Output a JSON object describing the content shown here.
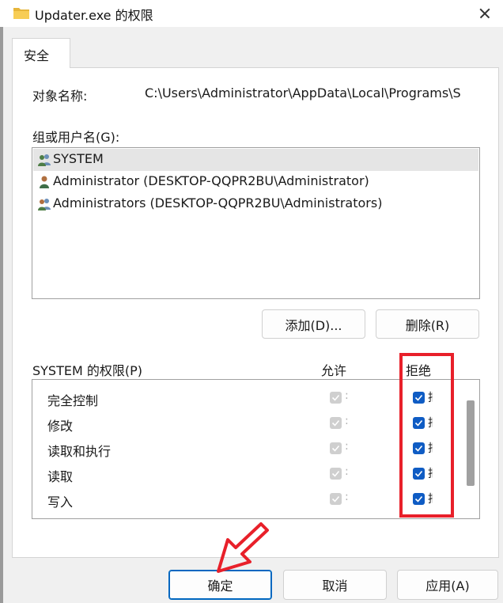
{
  "window": {
    "title": "Updater.exe 的权限",
    "icon": "folder-icon",
    "close_icon": "close-icon"
  },
  "tabs": [
    {
      "label": "安全"
    }
  ],
  "object": {
    "label": "对象名称:",
    "value": "C:\\Users\\Administrator\\AppData\\Local\\Programs\\S"
  },
  "groups": {
    "label": "组或用户名(G):",
    "items": [
      {
        "name": "SYSTEM",
        "icon": "users-group-icon",
        "selected": true
      },
      {
        "name": "Administrator (DESKTOP-QQPR2BU\\Administrator)",
        "icon": "user-icon",
        "selected": false
      },
      {
        "name": "Administrators (DESKTOP-QQPR2BU\\Administrators)",
        "icon": "users-group-icon",
        "selected": false
      }
    ]
  },
  "buttons": {
    "add": "添加(D)...",
    "remove": "删除(R)",
    "ok": "确定",
    "cancel": "取消",
    "apply": "应用(A)"
  },
  "permissions": {
    "header": "SYSTEM 的权限(P)",
    "allow_label": "允许",
    "deny_label": "拒绝",
    "rows": [
      {
        "name": "完全控制",
        "allow": true,
        "allow_disabled": true,
        "deny": true
      },
      {
        "name": "修改",
        "allow": true,
        "allow_disabled": true,
        "deny": true
      },
      {
        "name": "读取和执行",
        "allow": true,
        "allow_disabled": true,
        "deny": true
      },
      {
        "name": "读取",
        "allow": true,
        "allow_disabled": true,
        "deny": true
      },
      {
        "name": "写入",
        "allow": true,
        "allow_disabled": true,
        "deny": true
      }
    ],
    "allow_trail": ":",
    "deny_trail": "拒"
  },
  "annotation": {
    "box_color": "#e8202a",
    "arrow_color": "#e8202a"
  },
  "colors": {
    "accent": "#0067c0",
    "checked": "#0f5cc4",
    "disabled_check": "#cfcfcf"
  }
}
